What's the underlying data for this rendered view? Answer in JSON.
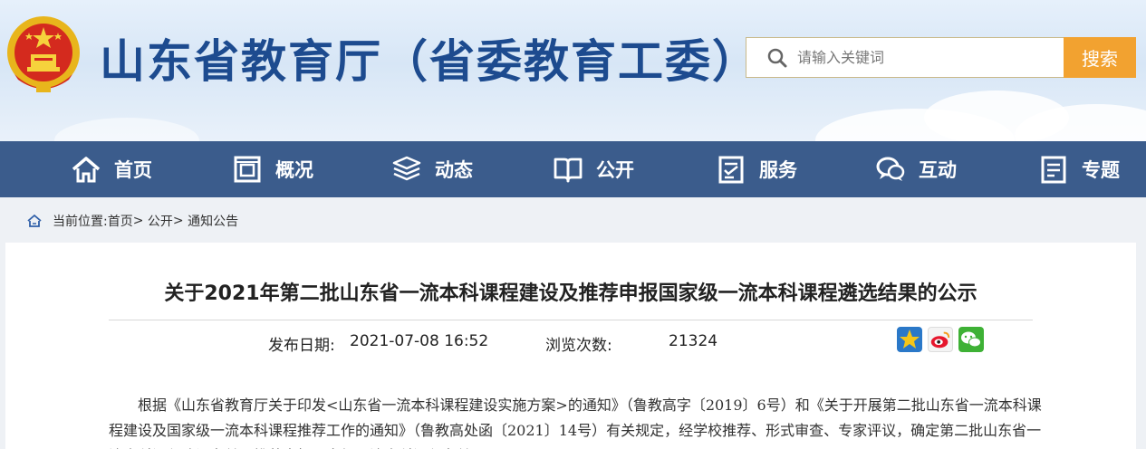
{
  "header": {
    "site_title": "山东省教育厅（省委教育工委）",
    "search_placeholder": "请输入关键词",
    "search_button": "搜索"
  },
  "nav": {
    "items": [
      {
        "label": "首页",
        "icon": "home-icon"
      },
      {
        "label": "概况",
        "icon": "overview-icon"
      },
      {
        "label": "动态",
        "icon": "news-icon"
      },
      {
        "label": "公开",
        "icon": "book-icon"
      },
      {
        "label": "服务",
        "icon": "service-icon"
      },
      {
        "label": "互动",
        "icon": "chat-icon"
      },
      {
        "label": "专题",
        "icon": "topic-icon"
      }
    ]
  },
  "breadcrumb": {
    "prefix": "当前位置: ",
    "items": [
      "首页",
      "公开",
      "通知公告"
    ],
    "separator": ">"
  },
  "article": {
    "title": "关于2021年第二批山东省一流本科课程建设及推荐申报国家级一流本科课程遴选结果的公示",
    "date_label": "发布日期:",
    "date_value": "2021-07-08 16:52",
    "views_label": "浏览次数:",
    "views_value": "21324",
    "body": "根据《山东省教育厅关于印发<山东省一流本科课程建设实施方案>的通知》（鲁教高字〔2019〕6号）和《关于开展第二批山东省一流本科课程建设及国家级一流本科课程推荐工作的通知》（鲁教高处函〔2021〕14号）有关规定，经学校推荐、形式审查、专家评议，确定第二批山东省一流本科课程建设名单及推荐申报国家级一流本科课程名单，现予以公示。"
  },
  "share": {
    "icons": [
      "favorite-star-icon",
      "weibo-icon",
      "wechat-icon"
    ]
  },
  "colors": {
    "title_blue": "#1d4b8f",
    "nav_bg": "#3b5c8c",
    "search_button": "#f2a230"
  }
}
